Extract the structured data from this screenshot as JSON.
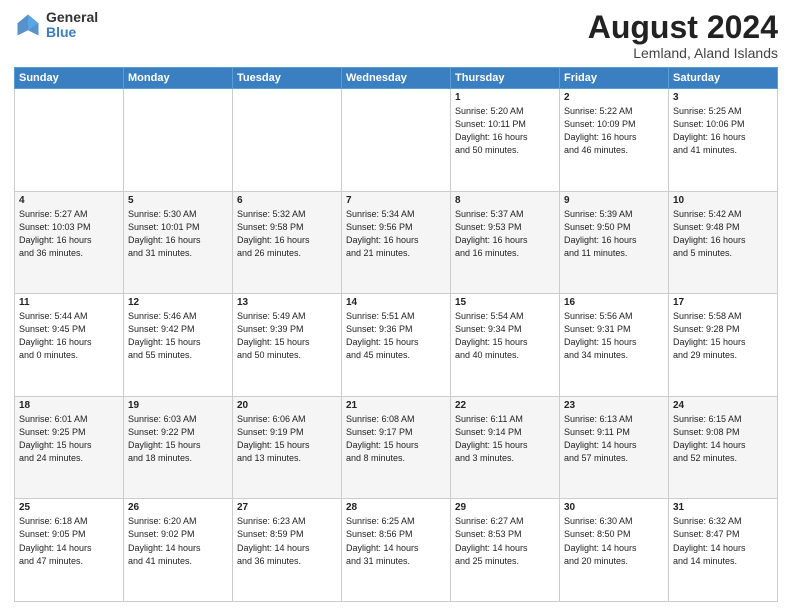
{
  "header": {
    "logo_general": "General",
    "logo_blue": "Blue",
    "main_title": "August 2024",
    "subtitle": "Lemland, Aland Islands"
  },
  "weekdays": [
    "Sunday",
    "Monday",
    "Tuesday",
    "Wednesday",
    "Thursday",
    "Friday",
    "Saturday"
  ],
  "weeks": [
    [
      {
        "day": "",
        "info": ""
      },
      {
        "day": "",
        "info": ""
      },
      {
        "day": "",
        "info": ""
      },
      {
        "day": "",
        "info": ""
      },
      {
        "day": "1",
        "info": "Sunrise: 5:20 AM\nSunset: 10:11 PM\nDaylight: 16 hours\nand 50 minutes."
      },
      {
        "day": "2",
        "info": "Sunrise: 5:22 AM\nSunset: 10:09 PM\nDaylight: 16 hours\nand 46 minutes."
      },
      {
        "day": "3",
        "info": "Sunrise: 5:25 AM\nSunset: 10:06 PM\nDaylight: 16 hours\nand 41 minutes."
      }
    ],
    [
      {
        "day": "4",
        "info": "Sunrise: 5:27 AM\nSunset: 10:03 PM\nDaylight: 16 hours\nand 36 minutes."
      },
      {
        "day": "5",
        "info": "Sunrise: 5:30 AM\nSunset: 10:01 PM\nDaylight: 16 hours\nand 31 minutes."
      },
      {
        "day": "6",
        "info": "Sunrise: 5:32 AM\nSunset: 9:58 PM\nDaylight: 16 hours\nand 26 minutes."
      },
      {
        "day": "7",
        "info": "Sunrise: 5:34 AM\nSunset: 9:56 PM\nDaylight: 16 hours\nand 21 minutes."
      },
      {
        "day": "8",
        "info": "Sunrise: 5:37 AM\nSunset: 9:53 PM\nDaylight: 16 hours\nand 16 minutes."
      },
      {
        "day": "9",
        "info": "Sunrise: 5:39 AM\nSunset: 9:50 PM\nDaylight: 16 hours\nand 11 minutes."
      },
      {
        "day": "10",
        "info": "Sunrise: 5:42 AM\nSunset: 9:48 PM\nDaylight: 16 hours\nand 5 minutes."
      }
    ],
    [
      {
        "day": "11",
        "info": "Sunrise: 5:44 AM\nSunset: 9:45 PM\nDaylight: 16 hours\nand 0 minutes."
      },
      {
        "day": "12",
        "info": "Sunrise: 5:46 AM\nSunset: 9:42 PM\nDaylight: 15 hours\nand 55 minutes."
      },
      {
        "day": "13",
        "info": "Sunrise: 5:49 AM\nSunset: 9:39 PM\nDaylight: 15 hours\nand 50 minutes."
      },
      {
        "day": "14",
        "info": "Sunrise: 5:51 AM\nSunset: 9:36 PM\nDaylight: 15 hours\nand 45 minutes."
      },
      {
        "day": "15",
        "info": "Sunrise: 5:54 AM\nSunset: 9:34 PM\nDaylight: 15 hours\nand 40 minutes."
      },
      {
        "day": "16",
        "info": "Sunrise: 5:56 AM\nSunset: 9:31 PM\nDaylight: 15 hours\nand 34 minutes."
      },
      {
        "day": "17",
        "info": "Sunrise: 5:58 AM\nSunset: 9:28 PM\nDaylight: 15 hours\nand 29 minutes."
      }
    ],
    [
      {
        "day": "18",
        "info": "Sunrise: 6:01 AM\nSunset: 9:25 PM\nDaylight: 15 hours\nand 24 minutes."
      },
      {
        "day": "19",
        "info": "Sunrise: 6:03 AM\nSunset: 9:22 PM\nDaylight: 15 hours\nand 18 minutes."
      },
      {
        "day": "20",
        "info": "Sunrise: 6:06 AM\nSunset: 9:19 PM\nDaylight: 15 hours\nand 13 minutes."
      },
      {
        "day": "21",
        "info": "Sunrise: 6:08 AM\nSunset: 9:17 PM\nDaylight: 15 hours\nand 8 minutes."
      },
      {
        "day": "22",
        "info": "Sunrise: 6:11 AM\nSunset: 9:14 PM\nDaylight: 15 hours\nand 3 minutes."
      },
      {
        "day": "23",
        "info": "Sunrise: 6:13 AM\nSunset: 9:11 PM\nDaylight: 14 hours\nand 57 minutes."
      },
      {
        "day": "24",
        "info": "Sunrise: 6:15 AM\nSunset: 9:08 PM\nDaylight: 14 hours\nand 52 minutes."
      }
    ],
    [
      {
        "day": "25",
        "info": "Sunrise: 6:18 AM\nSunset: 9:05 PM\nDaylight: 14 hours\nand 47 minutes."
      },
      {
        "day": "26",
        "info": "Sunrise: 6:20 AM\nSunset: 9:02 PM\nDaylight: 14 hours\nand 41 minutes."
      },
      {
        "day": "27",
        "info": "Sunrise: 6:23 AM\nSunset: 8:59 PM\nDaylight: 14 hours\nand 36 minutes."
      },
      {
        "day": "28",
        "info": "Sunrise: 6:25 AM\nSunset: 8:56 PM\nDaylight: 14 hours\nand 31 minutes."
      },
      {
        "day": "29",
        "info": "Sunrise: 6:27 AM\nSunset: 8:53 PM\nDaylight: 14 hours\nand 25 minutes."
      },
      {
        "day": "30",
        "info": "Sunrise: 6:30 AM\nSunset: 8:50 PM\nDaylight: 14 hours\nand 20 minutes."
      },
      {
        "day": "31",
        "info": "Sunrise: 6:32 AM\nSunset: 8:47 PM\nDaylight: 14 hours\nand 14 minutes."
      }
    ]
  ]
}
